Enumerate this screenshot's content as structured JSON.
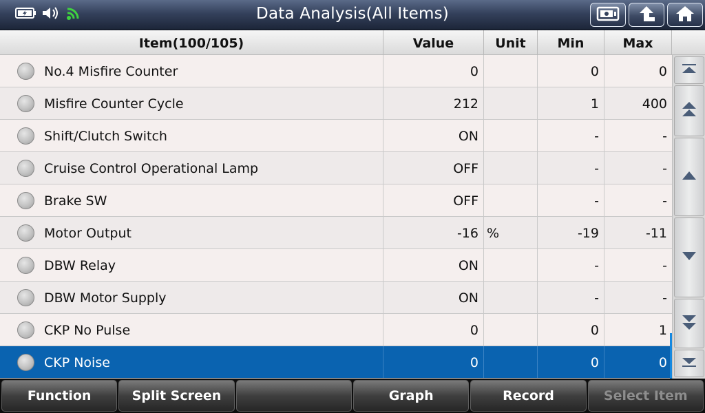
{
  "header": {
    "title": "Data Analysis(All Items)",
    "status_icons": [
      "battery-icon",
      "volume-icon",
      "wifi-icon"
    ],
    "buttons": [
      "screenshot-icon",
      "back-icon",
      "home-icon"
    ],
    "accent_color": "#1a6fbf"
  },
  "table": {
    "columns": {
      "item": "Item(100/105)",
      "value": "Value",
      "unit": "Unit",
      "min": "Min",
      "max": "Max"
    },
    "rows": [
      {
        "item": "No.4 Misfire Counter",
        "value": "0",
        "unit": "",
        "min": "0",
        "max": "0"
      },
      {
        "item": "Misfire Counter Cycle",
        "value": "212",
        "unit": "",
        "min": "1",
        "max": "400"
      },
      {
        "item": "Shift/Clutch Switch",
        "value": "ON",
        "unit": "",
        "min": "-",
        "max": "-"
      },
      {
        "item": "Cruise Control Operational Lamp",
        "value": "OFF",
        "unit": "",
        "min": "-",
        "max": "-"
      },
      {
        "item": "Brake SW",
        "value": "OFF",
        "unit": "",
        "min": "-",
        "max": "-"
      },
      {
        "item": "Motor Output",
        "value": "-16",
        "unit": "%",
        "min": "-19",
        "max": "-11"
      },
      {
        "item": "DBW Relay",
        "value": "ON",
        "unit": "",
        "min": "-",
        "max": "-"
      },
      {
        "item": "DBW Motor Supply",
        "value": "ON",
        "unit": "",
        "min": "-",
        "max": "-"
      },
      {
        "item": "CKP No Pulse",
        "value": "0",
        "unit": "",
        "min": "0",
        "max": "1"
      },
      {
        "item": "CKP Noise",
        "value": "0",
        "unit": "",
        "min": "0",
        "max": "0",
        "selected": true
      }
    ]
  },
  "scroll": {
    "buttons": [
      "scroll-top-icon",
      "page-up-icon",
      "scroll-up-icon",
      "scroll-down-icon",
      "page-down-icon",
      "scroll-bottom-icon"
    ]
  },
  "footer": {
    "buttons": [
      {
        "label": "Function",
        "enabled": true
      },
      {
        "label": "Split Screen",
        "enabled": true
      },
      {
        "label": "",
        "enabled": true
      },
      {
        "label": "Graph",
        "enabled": true
      },
      {
        "label": "Record",
        "enabled": true
      },
      {
        "label": "Select Item",
        "enabled": false
      }
    ]
  }
}
